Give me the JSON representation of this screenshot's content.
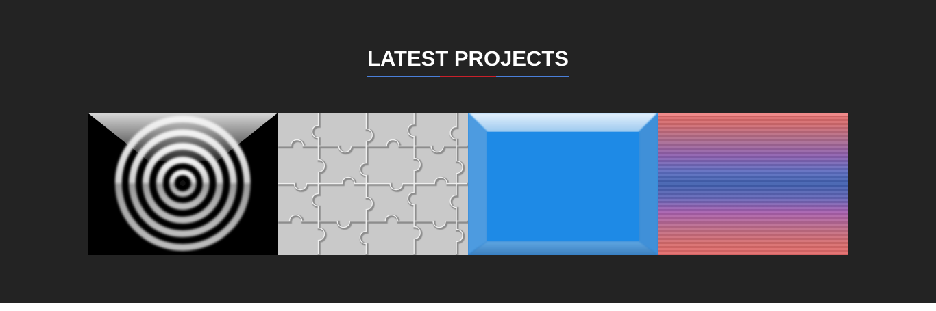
{
  "section": {
    "title": "LATEST PROJECTS",
    "background": "#232323",
    "underline_colors": [
      "#4a7fd9",
      "#c8202a"
    ]
  },
  "projects": [
    {
      "thumbnail": "concentric-rings-thumbnail"
    },
    {
      "thumbnail": "jigsaw-puzzle-thumbnail"
    },
    {
      "thumbnail": "blue-glossy-panel-thumbnail"
    },
    {
      "thumbnail": "striped-gradient-thumbnail"
    }
  ]
}
